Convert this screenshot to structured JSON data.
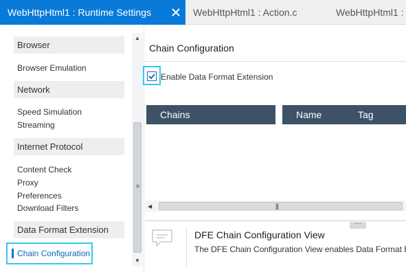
{
  "tabs": [
    {
      "label": "WebHttpHtml1 : Runtime Settings",
      "active": true
    },
    {
      "label": "WebHttpHtml1 : Action.c",
      "active": false
    },
    {
      "label": "WebHttpHtml1 : ",
      "active": false
    }
  ],
  "sidebar": {
    "sections": [
      {
        "header": "Browser",
        "items": [
          "Browser Emulation"
        ]
      },
      {
        "header": "Network",
        "items": [
          "Speed Simulation",
          "Streaming"
        ]
      },
      {
        "header": "Internet Protocol",
        "items": [
          "Content Check",
          "Proxy",
          "Preferences",
          "Download Filters"
        ]
      },
      {
        "header": "Data Format Extension",
        "items": [
          "Chain Configuration"
        ]
      }
    ],
    "selected_item": "Chain Configuration"
  },
  "content": {
    "title": "Chain Configuration",
    "enable_dfe": {
      "label": "Enable Data Format Extension",
      "checked": true
    },
    "grid_headers": {
      "chains": "Chains",
      "name": "Name",
      "tag": "Tag"
    }
  },
  "help_panel": {
    "title": "DFE Chain Configuration View",
    "description": "The DFE Chain Configuration View enables Data Format E"
  },
  "colors": {
    "accent": "#0a7ad8",
    "highlight_border": "#37c6f0",
    "grid_header": "#3d5267"
  }
}
